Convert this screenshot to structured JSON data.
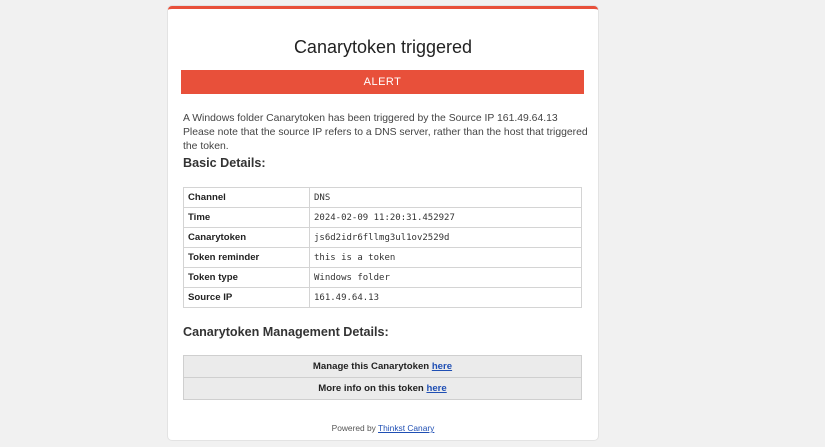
{
  "email": {
    "title": "Canarytoken triggered",
    "alert_label": "ALERT",
    "intro_text": "A Windows folder Canarytoken has been triggered by the Source IP 161.49.64.13 Please note that the source IP refers to a DNS server, rather than the host that triggered the token.",
    "accent_color": "#e8503a"
  },
  "basic_details": {
    "heading": "Basic Details:",
    "rows": [
      {
        "key": "Channel",
        "value": "DNS"
      },
      {
        "key": "Time",
        "value": "2024-02-09 11:20:31.452927"
      },
      {
        "key": "Canarytoken",
        "value": "js6d2idr6fllmg3ul1ov2529d"
      },
      {
        "key": "Token reminder",
        "value": "this is a token"
      },
      {
        "key": "Token type",
        "value": "Windows folder"
      },
      {
        "key": "Source IP",
        "value": "161.49.64.13"
      }
    ]
  },
  "management": {
    "heading": "Canarytoken Management Details:",
    "manage_text": "Manage this Canarytoken ",
    "manage_link": "here",
    "info_text": "More info on this token ",
    "info_link": "here"
  },
  "footer": {
    "prefix": "Powered by ",
    "link_text": "Thinkst Canary"
  }
}
